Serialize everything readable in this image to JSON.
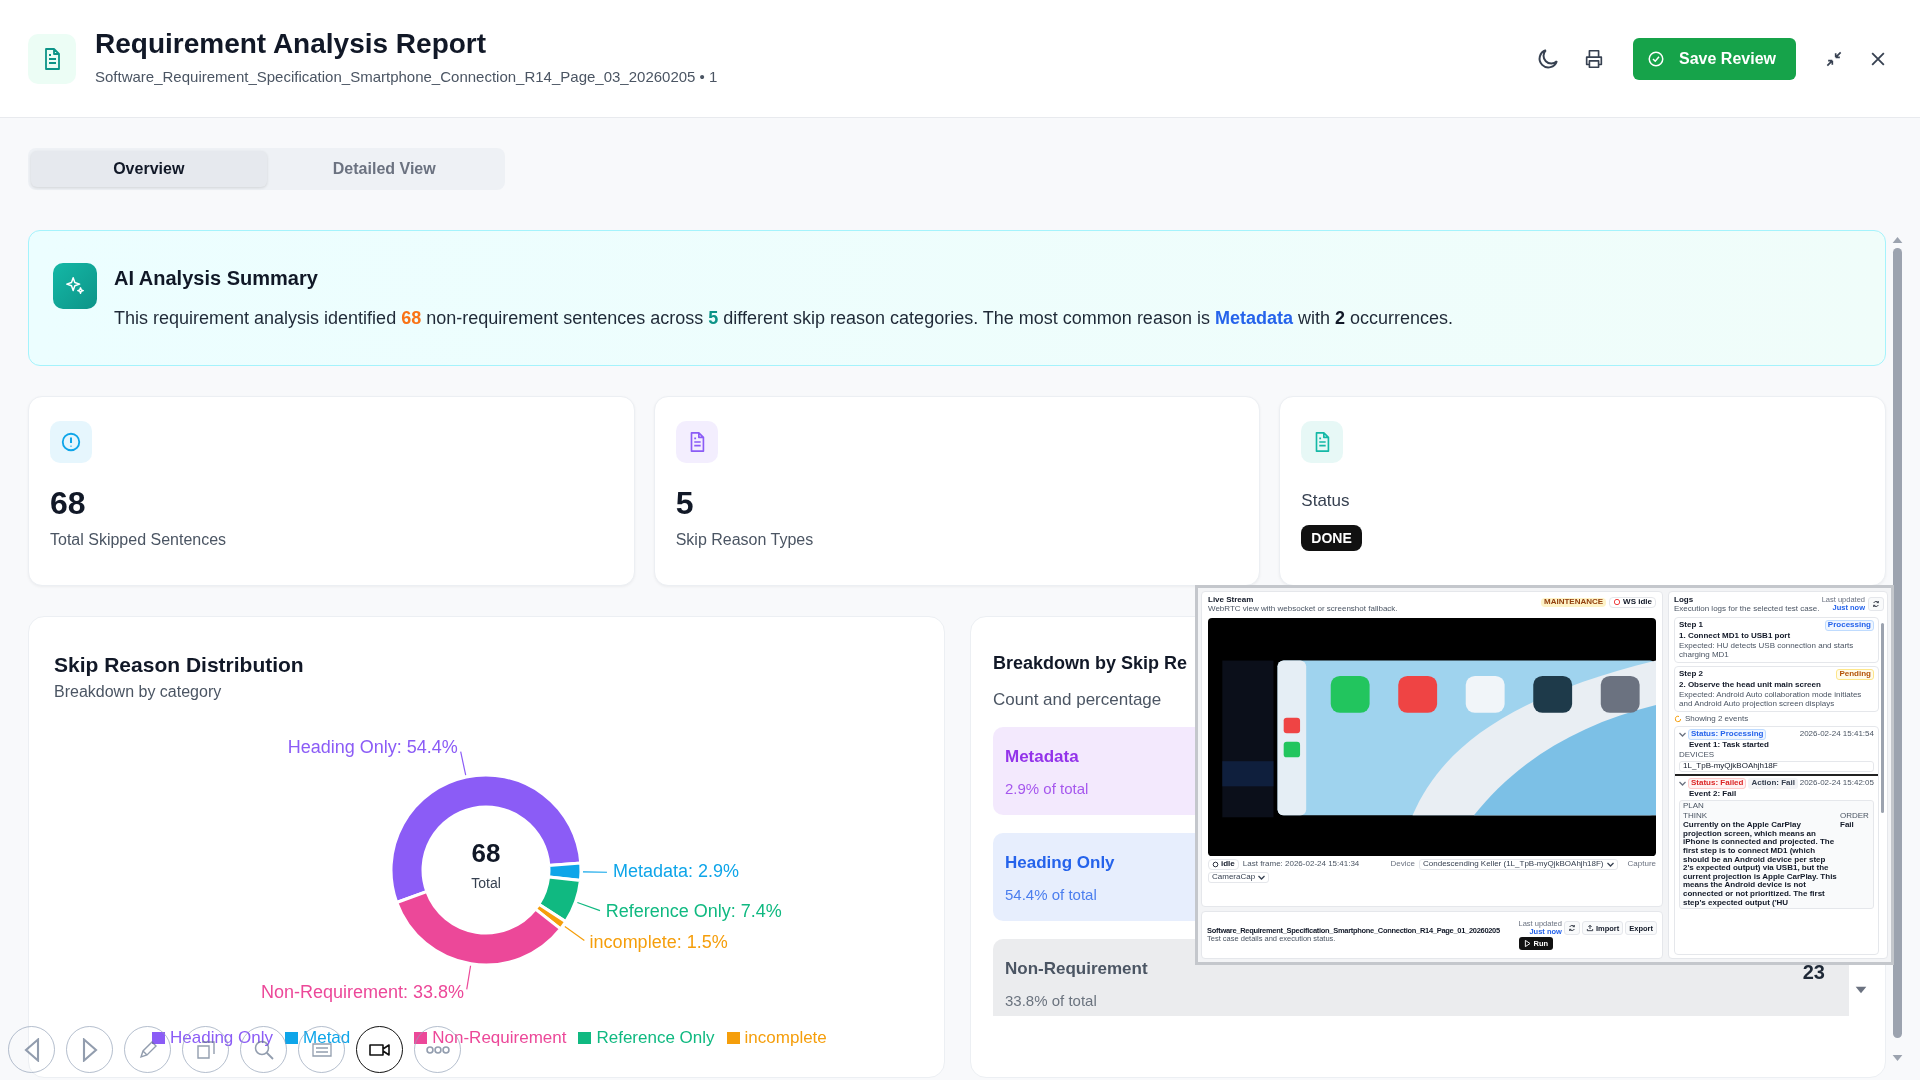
{
  "header": {
    "title": "Requirement Analysis Report",
    "subtitle": "Software_Requirement_Specification_Smartphone_Connection_R14_Page_03_20260205 • 1",
    "save_button": "Save Review"
  },
  "tabs": [
    {
      "label": "Overview",
      "selected": true
    },
    {
      "label": "Detailed View",
      "selected": false
    }
  ],
  "summary": {
    "title": "AI Analysis Summary",
    "segments": [
      {
        "kind": "plain",
        "text": "This requirement analysis identified "
      },
      {
        "kind": "count",
        "text": "68"
      },
      {
        "kind": "plain",
        "text": " non-requirement sentences across "
      },
      {
        "kind": "types",
        "text": "5"
      },
      {
        "kind": "plain",
        "text": " different skip reason categories. The most common reason is "
      },
      {
        "kind": "reason",
        "text": "Metadata"
      },
      {
        "kind": "plain",
        "text": " with "
      },
      {
        "kind": "occurrences",
        "text": "2"
      },
      {
        "kind": "plain",
        "text": " occurrences."
      }
    ]
  },
  "stats": [
    {
      "kind": "skipped",
      "color": "#0ea5e9",
      "value": "68",
      "label": "Total Skipped Sentences"
    },
    {
      "kind": "types",
      "color": "#8b5cf6",
      "value": "5",
      "label": "Skip Reason Types"
    },
    {
      "kind": "status",
      "color": "#14b8a6",
      "label": "Status",
      "badge": "DONE"
    }
  ],
  "distribution": {
    "title": "Skip Reason Distribution",
    "subtitle": "Breakdown by category",
    "center_value": "68",
    "center_label": "Total",
    "chart_data": {
      "type": "donut",
      "categories": [
        "Heading Only: 54.4%",
        "Metadata: 2.9%",
        "Reference Only: 7.4%",
        "incomplete: 1.5%",
        "Non-Requirement: 33.8%"
      ],
      "values": [
        54.4,
        2.9,
        7.4,
        1.5,
        33.8
      ],
      "colors": [
        "#8b5cf6",
        "#0ea5e9",
        "#10b981",
        "#f59e0b",
        "#ec4899"
      ]
    },
    "legend": [
      {
        "label": "Heading Only",
        "color": "#8b5cf6"
      },
      {
        "label": "Metad",
        "color": "#0ea5e9"
      },
      {
        "label": "Non-Requirement",
        "color": "#ec4899"
      },
      {
        "label": "Reference Only",
        "color": "#10b981"
      },
      {
        "label": "incomplete",
        "color": "#f59e0b"
      }
    ]
  },
  "breakdown": {
    "title": "Breakdown by Skip Re",
    "subtitle": "Count and percentage",
    "items": [
      {
        "name": "Metadata",
        "share": "2.9% of total",
        "color": "#9333ea"
      },
      {
        "name": "Heading Only",
        "share": "54.4% of total",
        "color": "#2563eb"
      },
      {
        "name": "Non-Requirement",
        "share": "33.8% of total",
        "count": "23",
        "color": "#4b5563"
      }
    ]
  },
  "stream_window": {
    "live": {
      "title": "Live Stream",
      "subtitle": "WebRTC view with websocket or screenshot fallback.",
      "mode_badge": "MAINTENANCE",
      "socket_status": "WS idle",
      "state": "idle",
      "last_frame": "Last frame: 2026-02-24 15:41:34",
      "device_label": "Device",
      "device": "Condescending Keller (1L_TpB-myQjkBOAhjh18F)",
      "capture_label": "Capture",
      "capture": "CameraCap"
    },
    "test_case": {
      "title": "Software_Requirement_Specification_Smartphone_Connection_R14_Page_01_20260205",
      "subtitle": "Test case details and execution status.",
      "updated_label": "Last updated",
      "updated": "Just now",
      "import": "Import",
      "export": "Export",
      "run": "Run"
    },
    "logs": {
      "title": "Logs",
      "subtitle": "Execution logs for the selected test case.",
      "updated_label": "Last updated",
      "updated": "Just now",
      "steps": [
        {
          "step": "Step 1",
          "kind": "processing",
          "status": "Processing",
          "title": "1. Connect MD1 to USB1 port",
          "expected": "Expected: HU detects USB connection and starts charging MD1"
        },
        {
          "step": "Step 2",
          "kind": "pending",
          "status": "Pending",
          "title": "2. Observe the head unit main screen",
          "expected": "Expected: Android Auto collaboration mode initiates and Android Auto projection screen displays"
        }
      ],
      "events_note": "Showing 2 events",
      "events": [
        {
          "kind": "processing",
          "status": "Status: Processing",
          "time": "2026-02-24 15:41:54",
          "title": "Event 1: Task started",
          "devices_label": "DEVICES",
          "device": "1L_TpB-myQjkBOAhjh18F"
        },
        {
          "kind": "failed",
          "status": "Status: Failed",
          "action": "Action: Fail",
          "time": "2026-02-24 15:42:05",
          "title": "Event 2: Fail",
          "plan": {
            "label": "PLAN",
            "think_label": "THINK",
            "think": "Currently on the Apple CarPlay projection screen, which means an iPhone is connected and projected. The first step is to connect MD1 (which should be an Android device per step 2's expected output) via USB1, but the current projection is Apple CarPlay. This means the Android device is not connected or not prioritized. The first step's expected output ('HU",
            "order_label": "ORDER",
            "order": "Fail"
          }
        }
      ]
    }
  }
}
